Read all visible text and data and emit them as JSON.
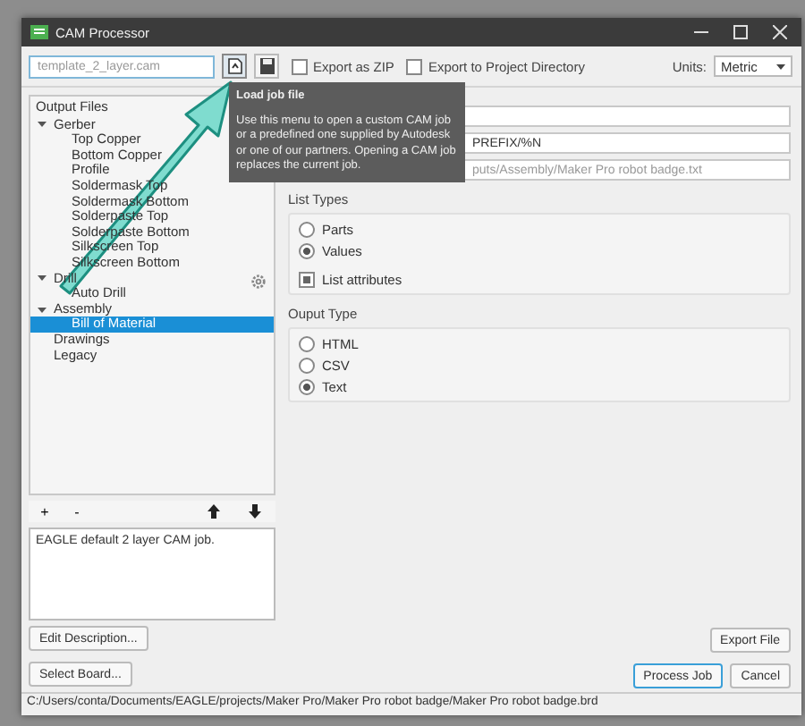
{
  "window": {
    "title": "CAM Processor"
  },
  "toolbar": {
    "job_field": {
      "placeholder": "template_2_layer.cam"
    },
    "export_zip": {
      "label": "Export as ZIP",
      "checked": false
    },
    "export_project": {
      "label": "Export to Project Directory",
      "checked": false
    },
    "units_label": "Units:",
    "units_value": "Metric"
  },
  "tooltip": {
    "title": "Load job file",
    "body": "Use this menu to open a custom CAM job or a predefined one supplied by Autodesk or one of our partners. Opening a CAM job replaces the current job."
  },
  "output_files": {
    "title": "Output Files",
    "items": [
      {
        "label": "Gerber",
        "expanded": true,
        "selected": false,
        "children": [
          {
            "label": "Top Copper",
            "selected": false
          },
          {
            "label": "Bottom Copper",
            "selected": false
          },
          {
            "label": "Profile",
            "selected": false
          },
          {
            "label": "Soldermask Top",
            "selected": false
          },
          {
            "label": "Soldermask Bottom",
            "selected": false
          },
          {
            "label": "Solderpaste Top",
            "selected": false
          },
          {
            "label": "Solderpaste Bottom",
            "selected": false
          },
          {
            "label": "Silkscreen Top",
            "selected": false
          },
          {
            "label": "Silkscreen Bottom",
            "selected": false
          }
        ]
      },
      {
        "label": "Drill",
        "expanded": true,
        "selected": false,
        "children": [
          {
            "label": "Auto Drill",
            "selected": false
          }
        ]
      },
      {
        "label": "Assembly",
        "expanded": true,
        "selected": false,
        "children": [
          {
            "label": "Bill of Material",
            "selected": true
          }
        ]
      },
      {
        "label": "Drawings",
        "selected": false
      },
      {
        "label": "Legacy",
        "selected": false
      }
    ]
  },
  "tree_buttons": {
    "add": "+",
    "remove": "-"
  },
  "description": "EAGLE default 2 layer CAM job.",
  "edit_description": "Edit Description...",
  "select_board": "Select Board...",
  "fields": [
    {
      "value": "PREFIX/%N"
    },
    {
      "value": "puts/Assembly/Maker Pro robot badge.txt"
    }
  ],
  "list_types": {
    "title": "List Types",
    "options": [
      {
        "label": "Parts",
        "selected": false
      },
      {
        "label": "Values",
        "selected": true
      }
    ],
    "list_attributes": {
      "label": "List attributes",
      "checked": true
    }
  },
  "output_type": {
    "title": "Ouput Type",
    "options": [
      {
        "label": "HTML",
        "selected": false
      },
      {
        "label": "CSV",
        "selected": false
      },
      {
        "label": "Text",
        "selected": true
      }
    ]
  },
  "export_file": "Export File",
  "process_job": "Process Job",
  "cancel": "Cancel",
  "status_bar": "C:/Users/conta/Documents/EAGLE/projects/Maker Pro/Maker Pro robot badge/Maker Pro robot badge.brd"
}
